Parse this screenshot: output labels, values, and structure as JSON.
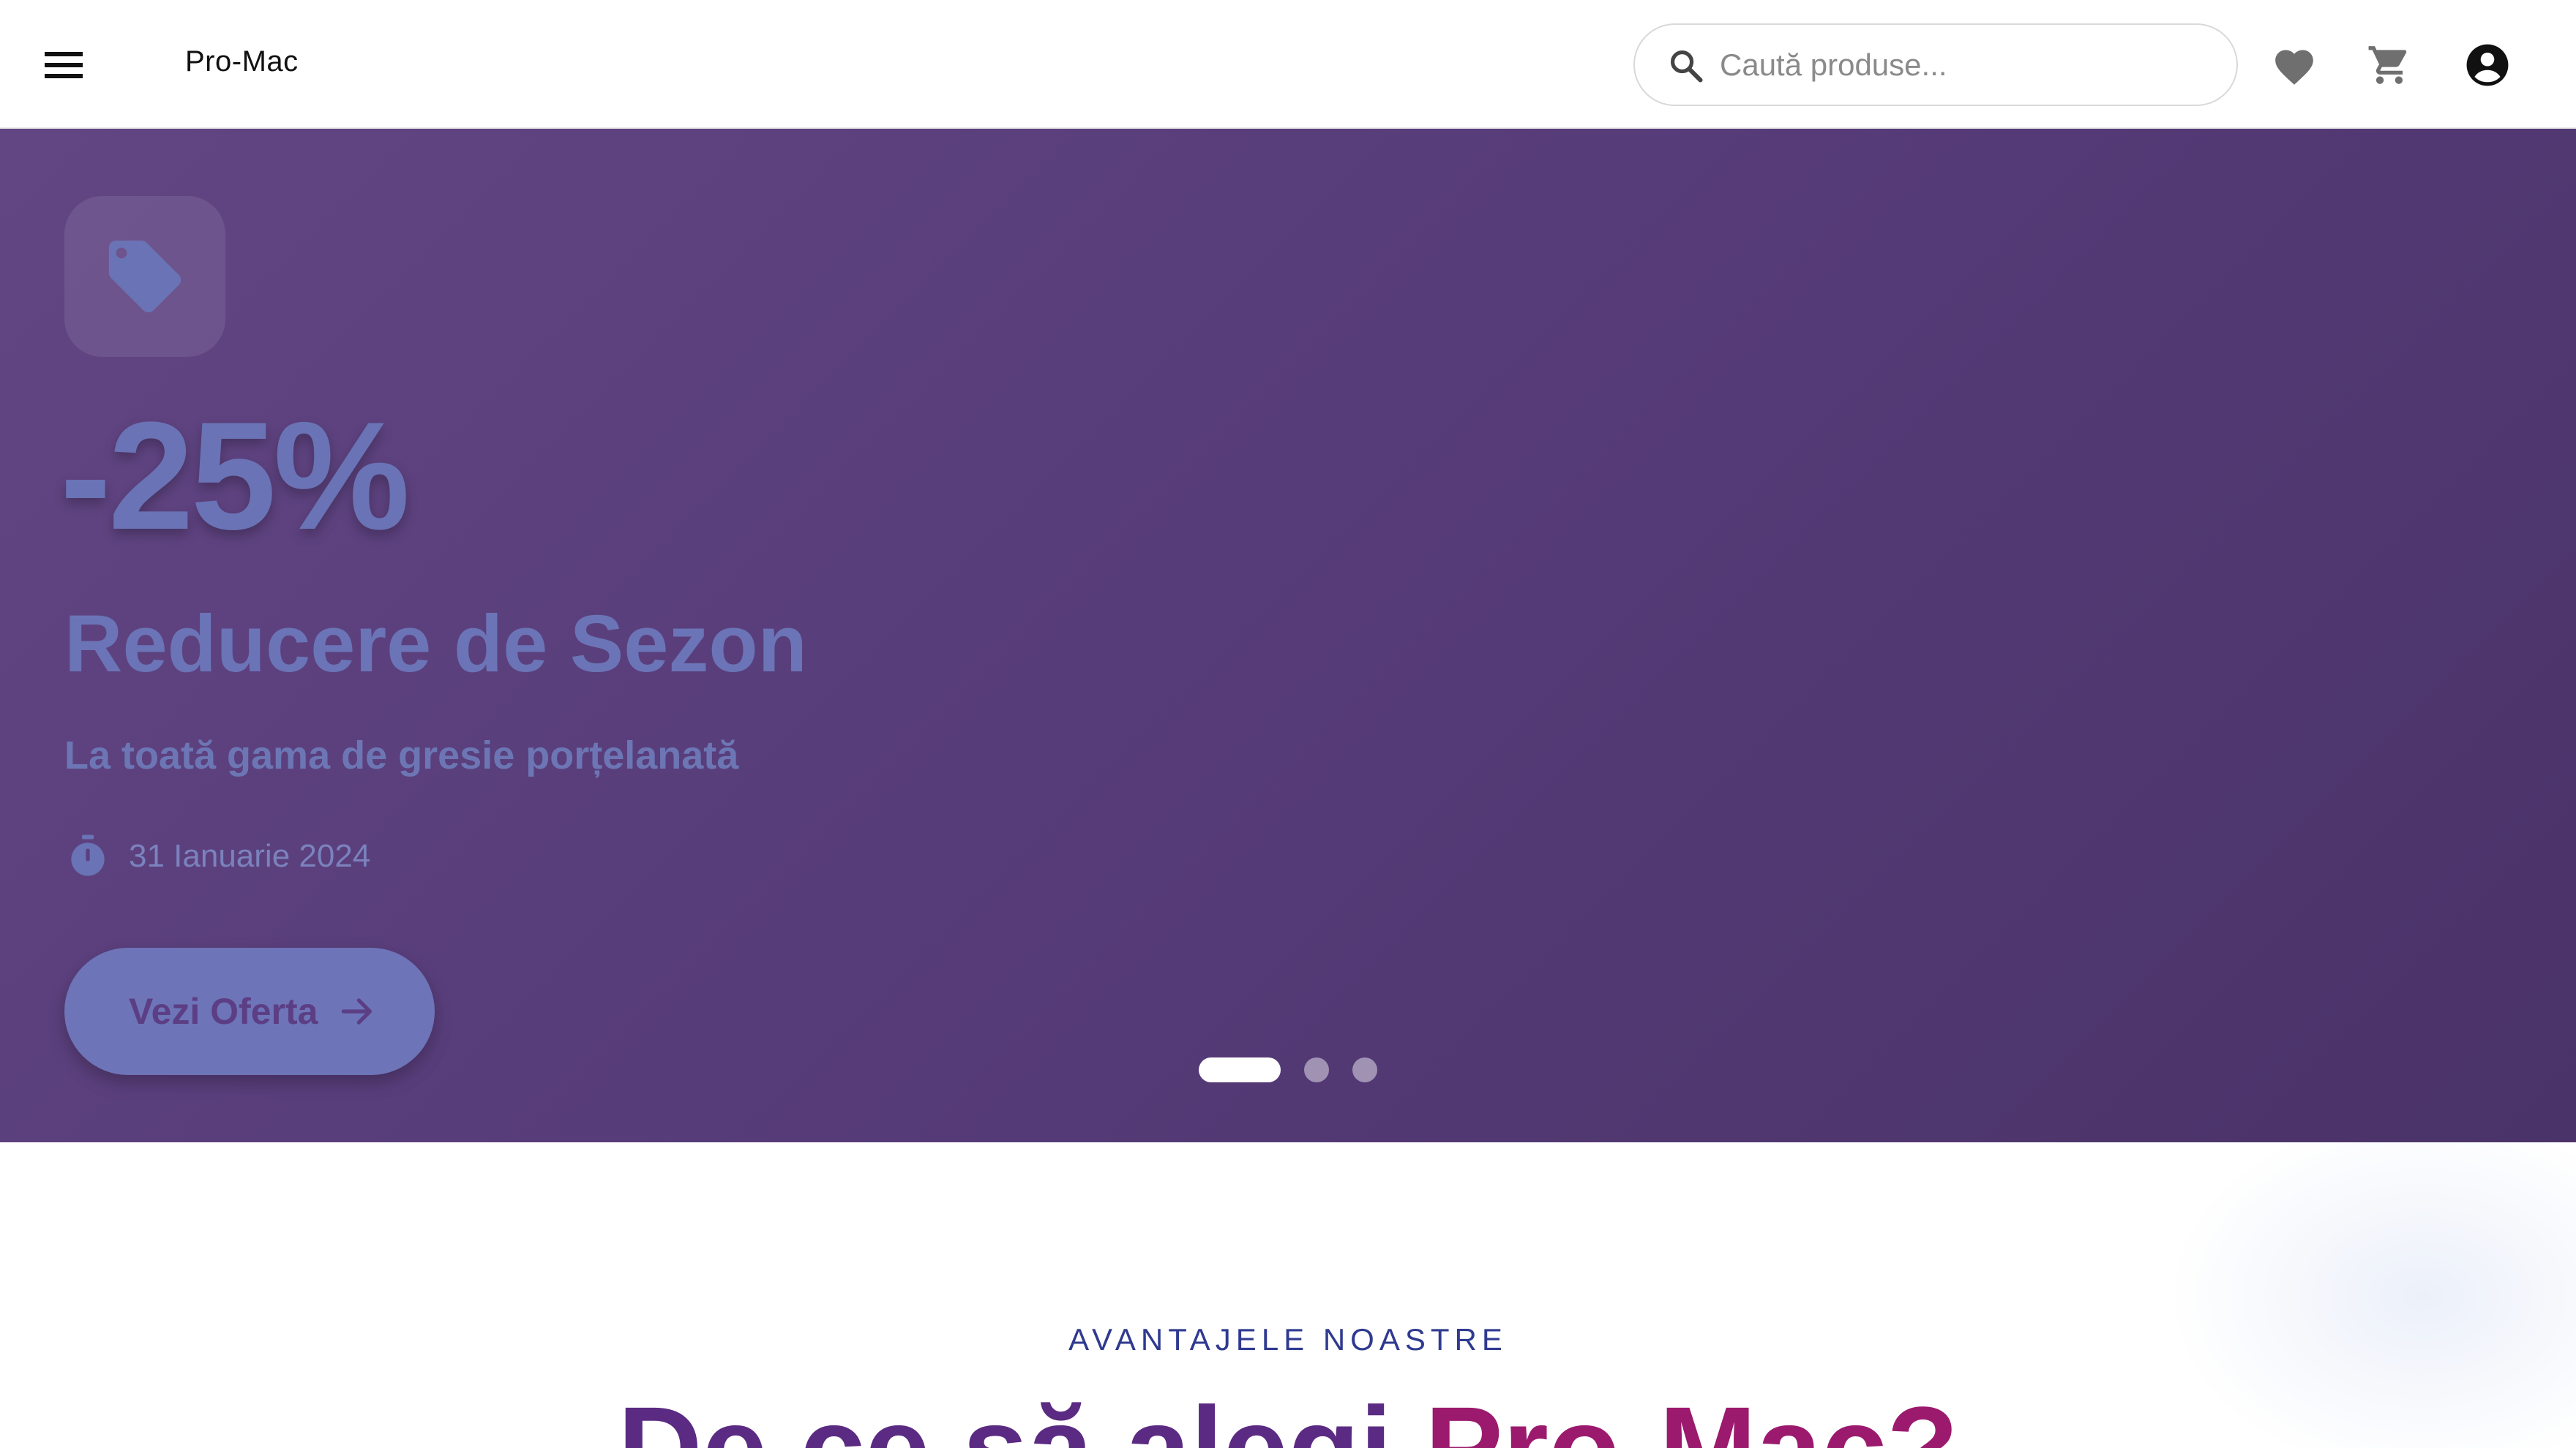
{
  "header": {
    "brand": "Pro-Mac",
    "search_placeholder": "Caută produse..."
  },
  "icons": {
    "menu": "menu-icon",
    "search": "search-icon",
    "wishlist": "heart-icon",
    "cart": "cart-icon",
    "account": "account-circle-icon",
    "tag": "tag-icon",
    "timer": "timer-icon",
    "arrow": "arrow-right-icon"
  },
  "hero": {
    "discount": "-25%",
    "title": "Reducere de Sezon",
    "subtitle": "La toată gama de gresie porțelanată",
    "date": "31 Ianuarie 2024",
    "cta_label": "Vezi Oferta",
    "slides_total": 3,
    "active_slide": 1
  },
  "advantages": {
    "eyebrow": "AVANTAJELE NOASTRE",
    "heading_part1": "De ce să alegi ",
    "heading_part2": "Pro-Mac?"
  },
  "colors": {
    "hero_bg_start": "#624683",
    "hero_bg_end": "#4a3368",
    "hero_text": "#6b74b6",
    "cta_bg": "#6e74b8",
    "cta_text": "#5c3e84",
    "eyebrow": "#2f3a8f",
    "heading_primary": "#5b2a82",
    "heading_accent": "#9b1a6e"
  }
}
